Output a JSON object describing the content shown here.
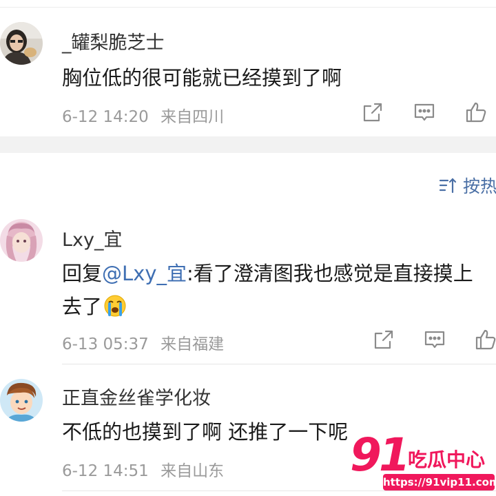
{
  "sort": {
    "label": "按热"
  },
  "comments": [
    {
      "user": "_罐梨脆芝士",
      "text": "胸位低的很可能就已经摸到了啊",
      "date": "6-12 14:20",
      "location": "来自四川"
    },
    {
      "user": "Lxy_宜",
      "reply_prefix": "回复",
      "mention": "@Lxy_宜",
      "text_line1": ":看了澄清图我也感觉是直接摸上",
      "text_line2": "去了",
      "emoji": "crying-face",
      "date": "6-13 05:37",
      "location": "来自福建"
    },
    {
      "user": "正直金丝雀学化妆",
      "text": "不低的也摸到了啊  还推了一下呢",
      "date": "6-12 14:51",
      "location": "来自山东"
    }
  ],
  "watermark": {
    "brand_number": "91",
    "brand_text": "吃瓜中心",
    "url": "https://91vip11.com"
  },
  "icons": [
    "share-icon",
    "comment-icon",
    "like-icon",
    "sort-icon"
  ],
  "colors": {
    "link": "#3f6fb3",
    "meta": "#9a9a9a",
    "watermark": "#f0185c"
  }
}
